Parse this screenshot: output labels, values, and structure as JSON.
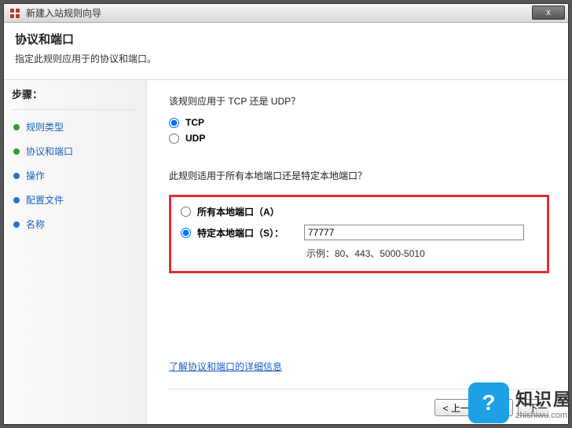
{
  "titlebar": {
    "text": "新建入站规则向导",
    "close": "x"
  },
  "header": {
    "title": "协议和端口",
    "desc": "指定此规则应用于的协议和端口。"
  },
  "sidebar": {
    "heading": "步骤：",
    "steps": [
      {
        "label": "规则类型"
      },
      {
        "label": "协议和端口"
      },
      {
        "label": "操作"
      },
      {
        "label": "配置文件"
      },
      {
        "label": "名称"
      }
    ]
  },
  "content": {
    "q1": "该规则应用于 TCP 还是 UDP？",
    "tcp": "TCP",
    "udp": "UDP",
    "q2": "此规则适用于所有本地端口还是特定本地端口？",
    "all_ports": "所有本地端口（A）",
    "specific_ports": "特定本地端口（S）：",
    "port_value": "77777",
    "example": "示例：80、443、5000-5010",
    "link": "了解协议和端口的详细信息"
  },
  "buttons": {
    "back": "< 上一步（B）",
    "next": "下一"
  },
  "watermark": {
    "badge": "?",
    "cn": "知识屋",
    "url": "zhishiwu.com"
  }
}
